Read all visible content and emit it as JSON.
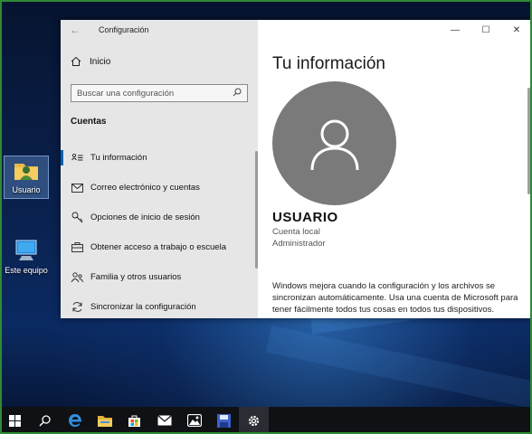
{
  "desktop": {
    "icons": [
      {
        "label": "Usuario",
        "icon": "user-folder-icon"
      },
      {
        "label": "Este equipo",
        "icon": "computer-icon"
      }
    ]
  },
  "window": {
    "app_title": "Configuración",
    "controls": {
      "minimize": "—",
      "maximize": "☐",
      "close": "✕"
    }
  },
  "sidebar": {
    "home_label": "Inicio",
    "search_placeholder": "Buscar una configuración",
    "section_title": "Cuentas",
    "items": [
      {
        "label": "Tu información",
        "icon": "user-card-icon",
        "active": true
      },
      {
        "label": "Correo electrónico y cuentas",
        "icon": "mail-icon",
        "active": false
      },
      {
        "label": "Opciones de inicio de sesión",
        "icon": "key-icon",
        "active": false
      },
      {
        "label": "Obtener acceso a trabajo o escuela",
        "icon": "briefcase-icon",
        "active": false
      },
      {
        "label": "Familia y otros usuarios",
        "icon": "people-icon",
        "active": false
      },
      {
        "label": "Sincronizar la configuración",
        "icon": "sync-icon",
        "active": false
      }
    ]
  },
  "main": {
    "title": "Tu información",
    "user_name": "USUARIO",
    "account_type": "Cuenta local",
    "role": "Administrador",
    "sync_message": "Windows mejora cuando la configuración y los archivos se sincronizan automáticamente. Usa una cuenta de Microsoft para tener fácilmente todos tus cosas en todos tus dispositivos."
  },
  "taskbar": {
    "items": [
      "start-icon",
      "search-icon",
      "edge-icon",
      "file-explorer-icon",
      "store-icon",
      "mail-icon",
      "photos-icon",
      "save-icon",
      "settings-icon"
    ],
    "active": "settings-icon"
  },
  "colors": {
    "accent": "#0063b1",
    "sidebar_bg": "#e6e6e6",
    "avatar_bg": "#7a7a7a",
    "taskbar_bg": "#0f1115"
  }
}
